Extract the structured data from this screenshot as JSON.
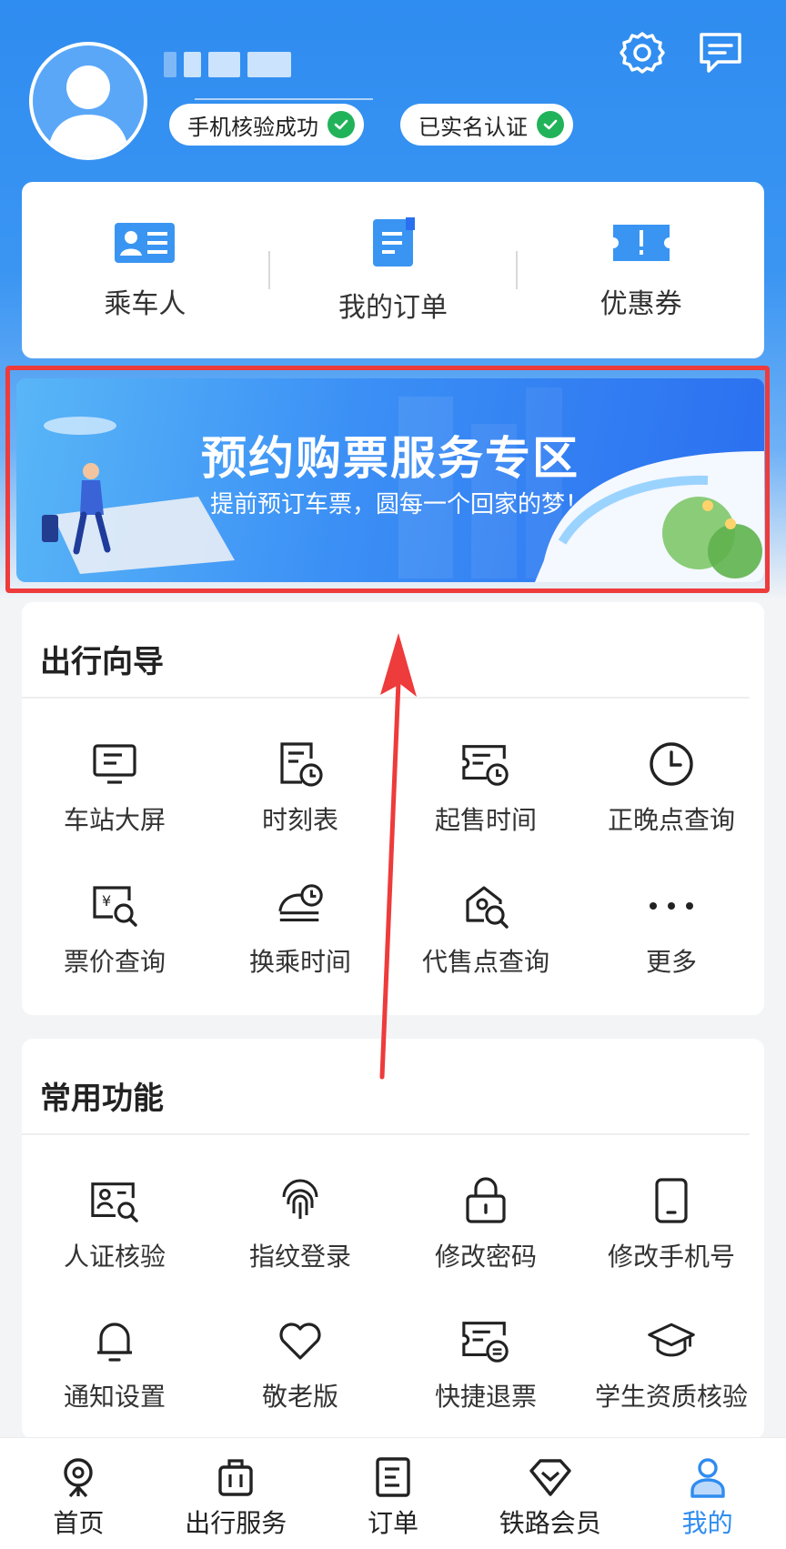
{
  "profile": {
    "badges": [
      {
        "label": "手机核验成功"
      },
      {
        "label": "已实名认证"
      }
    ]
  },
  "header_icons": [
    "settings-icon",
    "message-icon"
  ],
  "quick_links": [
    {
      "label": "乘车人",
      "icon": "passenger-card-icon"
    },
    {
      "label": "我的订单",
      "icon": "order-doc-icon"
    },
    {
      "label": "优惠券",
      "icon": "coupon-ticket-icon"
    }
  ],
  "banner": {
    "title": "预约购票服务专区",
    "subtitle": "提前预订车票，圆每一个回家的梦！"
  },
  "travel_guide": {
    "title": "出行向导",
    "items": [
      {
        "label": "车站大屏",
        "icon": "station-screen-icon"
      },
      {
        "label": "时刻表",
        "icon": "timetable-icon"
      },
      {
        "label": "起售时间",
        "icon": "sale-time-icon"
      },
      {
        "label": "正晚点查询",
        "icon": "clock-icon"
      },
      {
        "label": "票价查询",
        "icon": "fare-search-icon"
      },
      {
        "label": "换乘时间",
        "icon": "transfer-time-icon"
      },
      {
        "label": "代售点查询",
        "icon": "agency-search-icon"
      },
      {
        "label": "更多",
        "icon": "more-icon"
      }
    ]
  },
  "common_functions": {
    "title": "常用功能",
    "items": [
      {
        "label": "人证核验",
        "icon": "id-verify-icon"
      },
      {
        "label": "指纹登录",
        "icon": "fingerprint-icon"
      },
      {
        "label": "修改密码",
        "icon": "lock-icon"
      },
      {
        "label": "修改手机号",
        "icon": "phone-icon"
      },
      {
        "label": "通知设置",
        "icon": "bell-icon"
      },
      {
        "label": "敬老版",
        "icon": "heart-icon"
      },
      {
        "label": "快捷退票",
        "icon": "refund-ticket-icon"
      },
      {
        "label": "学生资质核验",
        "icon": "graduation-cap-icon"
      }
    ]
  },
  "tabbar": [
    {
      "label": "首页",
      "icon": "home-train-icon",
      "active": false
    },
    {
      "label": "出行服务",
      "icon": "luggage-icon",
      "active": false
    },
    {
      "label": "订单",
      "icon": "order-icon",
      "active": false
    },
    {
      "label": "铁路会员",
      "icon": "diamond-icon",
      "active": false
    },
    {
      "label": "我的",
      "icon": "user-icon",
      "active": true
    }
  ],
  "colors": {
    "primary": "#2f8cf0",
    "success": "#21b35a",
    "annotation": "#ee3b3b"
  }
}
